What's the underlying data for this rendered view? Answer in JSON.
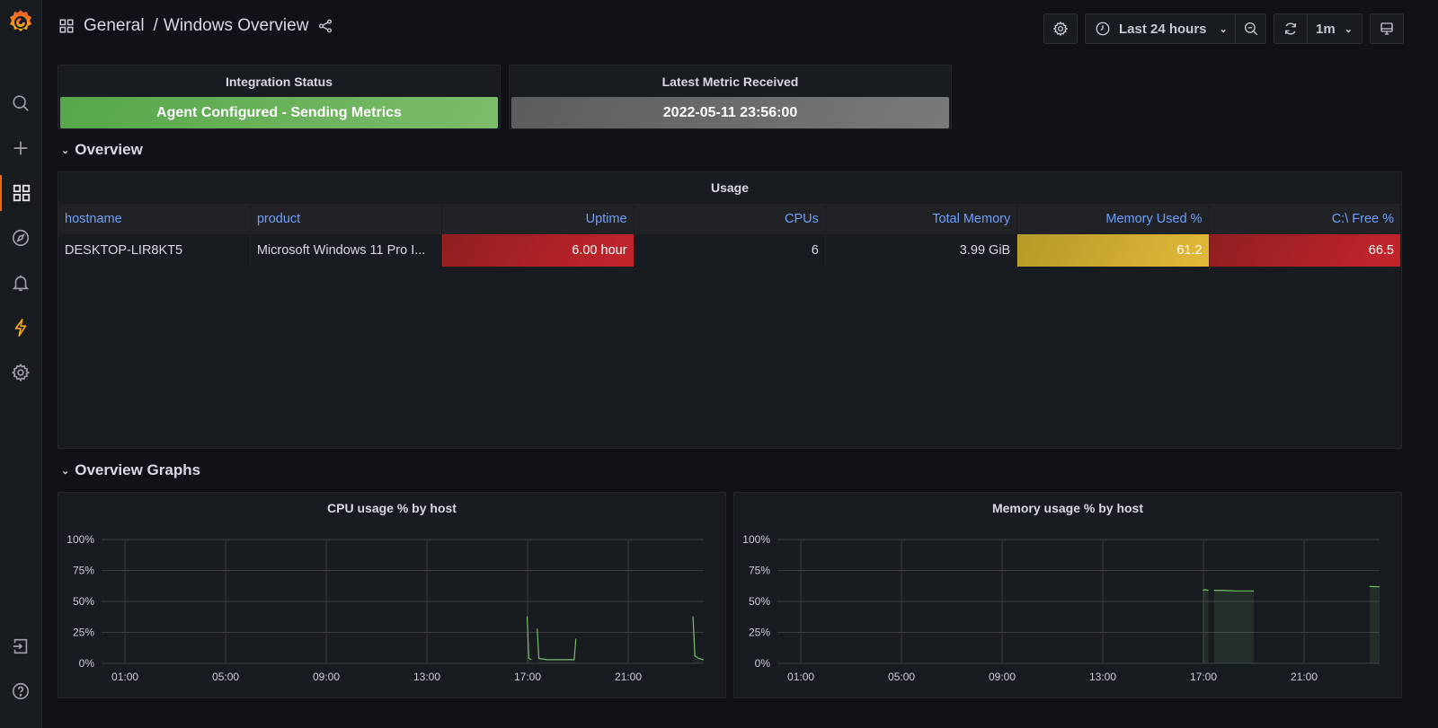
{
  "breadcrumb": {
    "folder": "General",
    "separator": "/",
    "dashboard": "Windows Overview"
  },
  "toolbar": {
    "time_range": "Last 24 hours",
    "refresh_interval": "1m"
  },
  "sidebar": {
    "items": [
      {
        "name": "search",
        "label": "Search"
      },
      {
        "name": "create",
        "label": "Create"
      },
      {
        "name": "dashboards",
        "label": "Dashboards",
        "active": true
      },
      {
        "name": "explore",
        "label": "Explore"
      },
      {
        "name": "alerting",
        "label": "Alerting"
      },
      {
        "name": "integrations",
        "label": "Integrations"
      },
      {
        "name": "configuration",
        "label": "Configuration"
      },
      {
        "name": "sign-in",
        "label": "Sign in"
      },
      {
        "name": "help",
        "label": "Help"
      }
    ]
  },
  "stats": {
    "integration": {
      "title": "Integration Status",
      "value": "Agent Configured - Sending Metrics",
      "color": "#73bf69"
    },
    "latest": {
      "title": "Latest Metric Received",
      "value": "2022-05-11 23:56:00",
      "color": "#707070"
    }
  },
  "rows": {
    "overview": "Overview",
    "overview_graphs": "Overview Graphs"
  },
  "usage_table": {
    "title": "Usage",
    "columns": [
      "hostname",
      "product",
      "Uptime",
      "CPUs",
      "Total Memory",
      "Memory Used %",
      "C:\\ Free %"
    ],
    "rows": [
      [
        "DESKTOP-LIR8KT5",
        "Microsoft Windows 11 Pro I...",
        "6.00 hour",
        "6",
        "3.99 GiB",
        "61.2",
        "66.5"
      ]
    ]
  },
  "chart_data": [
    {
      "type": "line",
      "title": "CPU usage % by host",
      "xlabel": "",
      "ylabel": "",
      "ylim": [
        0,
        100
      ],
      "yticks": [
        "0%",
        "25%",
        "50%",
        "75%",
        "100%"
      ],
      "yvalues": [
        0,
        25,
        50,
        75,
        100
      ],
      "xlim_hours": [
        0.07,
        24.0
      ],
      "xticks": [
        "01:00",
        "05:00",
        "09:00",
        "13:00",
        "17:00",
        "21:00"
      ],
      "xtick_hours": [
        1,
        5,
        9,
        13,
        17,
        21
      ],
      "grid": true,
      "series": [
        {
          "name": "DESKTOP-LIR8KT5",
          "color": "#73bf69",
          "segments": [
            [
              [
                16.98,
                38
              ],
              [
                17.05,
                4
              ],
              [
                17.15,
                3
              ]
            ],
            [
              [
                17.38,
                28
              ],
              [
                17.45,
                4
              ],
              [
                17.8,
                3
              ],
              [
                18.3,
                3
              ],
              [
                18.85,
                3
              ],
              [
                18.92,
                20
              ]
            ],
            [
              [
                23.57,
                38
              ],
              [
                23.65,
                6
              ],
              [
                23.8,
                4
              ],
              [
                24.0,
                3
              ]
            ]
          ]
        }
      ]
    },
    {
      "type": "area",
      "title": "Memory usage % by host",
      "xlabel": "",
      "ylabel": "",
      "ylim": [
        0,
        100
      ],
      "yticks": [
        "0%",
        "25%",
        "50%",
        "75%",
        "100%"
      ],
      "yvalues": [
        0,
        25,
        50,
        75,
        100
      ],
      "xlim_hours": [
        0.07,
        24.0
      ],
      "xticks": [
        "01:00",
        "05:00",
        "09:00",
        "13:00",
        "17:00",
        "21:00"
      ],
      "xtick_hours": [
        1,
        5,
        9,
        13,
        17,
        21
      ],
      "grid": true,
      "series": [
        {
          "name": "DESKTOP-LIR8KT5",
          "color": "#73bf69",
          "segments": [
            [
              [
                16.97,
                59
              ],
              [
                17.05,
                59.5
              ],
              [
                17.2,
                59
              ]
            ],
            [
              [
                17.42,
                59
              ],
              [
                17.7,
                59
              ],
              [
                18.3,
                58.5
              ],
              [
                19.0,
                58.5
              ]
            ],
            [
              [
                23.6,
                62
              ],
              [
                24.0,
                61.8
              ]
            ]
          ]
        }
      ]
    }
  ]
}
